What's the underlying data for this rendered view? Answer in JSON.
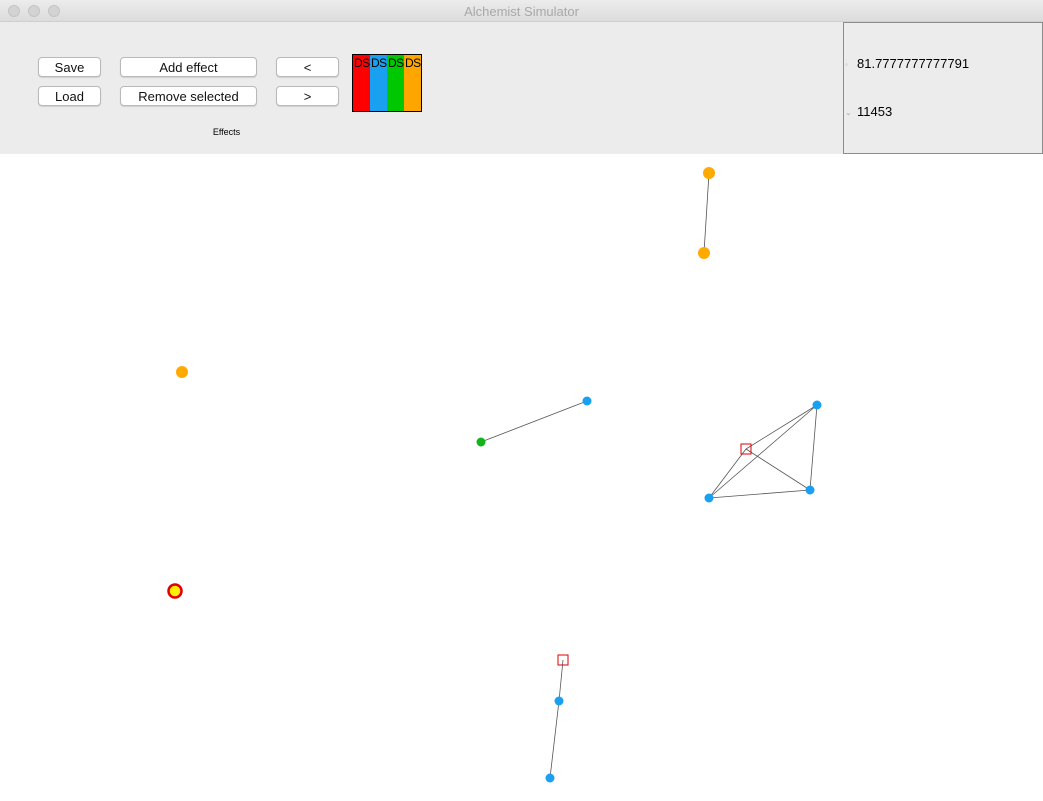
{
  "window": {
    "title": "Alchemist Simulator"
  },
  "toolbar": {
    "save_label": "Save",
    "load_label": "Load",
    "add_effect_label": "Add effect",
    "remove_selected_label": "Remove selected",
    "prev_label": "<",
    "next_label": ">",
    "effects_label": "Effects"
  },
  "color_swatches": [
    {
      "text": "DS",
      "color": "#ff0000"
    },
    {
      "text": "DS",
      "color": "#1aa0f0"
    },
    {
      "text": "DS",
      "color": "#00c800"
    },
    {
      "text": "DS",
      "color": "#ffa500"
    }
  ],
  "info": {
    "time_value": "81.7777777777791",
    "step_value": "11453"
  },
  "colors": {
    "orange": "#ffaa00",
    "blue": "#1aa0f0",
    "green": "#13b41a",
    "red": "#e00000",
    "yellow": "#ffee00",
    "link": "#555555"
  }
}
